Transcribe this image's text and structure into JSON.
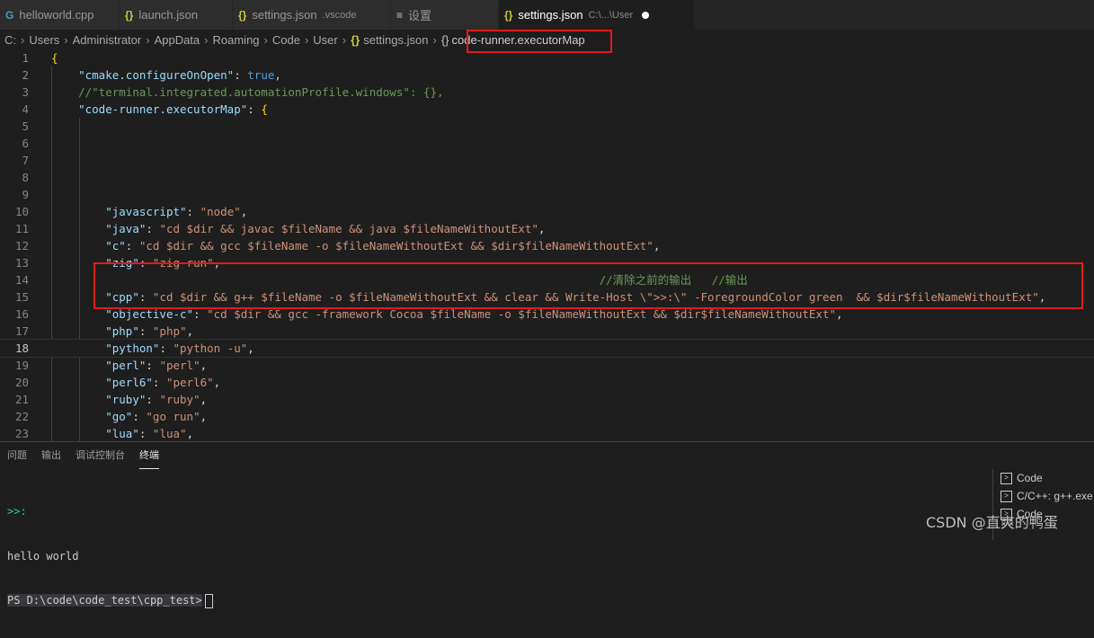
{
  "tabs": [
    {
      "icon": "cpp-file-icon",
      "glyph": "G",
      "label": "helloworld.cpp",
      "path": "",
      "active": false
    },
    {
      "icon": "json-file-icon",
      "glyph": "{}",
      "label": "launch.json",
      "path": "",
      "active": false
    },
    {
      "icon": "json-file-icon",
      "glyph": "{}",
      "label": "settings.json",
      "path": ".vscode",
      "active": false
    },
    {
      "icon": "settings-list-icon",
      "glyph": "≡",
      "label": "设置",
      "path": "",
      "active": false
    },
    {
      "icon": "json-file-icon",
      "glyph": "{}",
      "label": "settings.json",
      "path": "C:\\...\\User",
      "active": true
    }
  ],
  "breadcrumb": {
    "items": [
      "C:",
      "Users",
      "Administrator",
      "AppData",
      "Roaming",
      "Code",
      "User"
    ],
    "file_glyph": "{}",
    "file": "settings.json",
    "key_glyph": "{}",
    "key": "code-runner.executorMap"
  },
  "editor": {
    "current_line": 18,
    "lines": [
      {
        "n": "1",
        "code": [
          [
            "brk",
            "{"
          ]
        ]
      },
      {
        "n": "2",
        "code": [
          [
            "p",
            "    "
          ],
          [
            "k",
            "\"cmake.configureOnOpen\""
          ],
          [
            "p",
            ": "
          ],
          [
            "b",
            "true"
          ],
          [
            "p",
            ","
          ]
        ]
      },
      {
        "n": "3",
        "code": [
          [
            "p",
            "    "
          ],
          [
            "c",
            "//\"terminal.integrated.automationProfile.windows\": {},"
          ]
        ]
      },
      {
        "n": "4",
        "code": [
          [
            "p",
            "    "
          ],
          [
            "k",
            "\"code-runner.executorMap\""
          ],
          [
            "p",
            ": "
          ],
          [
            "brk",
            "{"
          ]
        ]
      },
      {
        "n": "5",
        "code": []
      },
      {
        "n": "6",
        "code": []
      },
      {
        "n": "7",
        "code": []
      },
      {
        "n": "8",
        "code": []
      },
      {
        "n": "9",
        "code": []
      },
      {
        "n": "10",
        "code": [
          [
            "p",
            "        "
          ],
          [
            "k",
            "\"javascript\""
          ],
          [
            "p",
            ": "
          ],
          [
            "s",
            "\"node\""
          ],
          [
            "p",
            ","
          ]
        ]
      },
      {
        "n": "11",
        "code": [
          [
            "p",
            "        "
          ],
          [
            "k",
            "\"java\""
          ],
          [
            "p",
            ": "
          ],
          [
            "s",
            "\"cd $dir && javac $fileName && java $fileNameWithoutExt\""
          ],
          [
            "p",
            ","
          ]
        ]
      },
      {
        "n": "12",
        "code": [
          [
            "p",
            "        "
          ],
          [
            "k",
            "\"c\""
          ],
          [
            "p",
            ": "
          ],
          [
            "s",
            "\"cd $dir && gcc $fileName -o $fileNameWithoutExt && $dir$fileNameWithoutExt\""
          ],
          [
            "p",
            ","
          ]
        ]
      },
      {
        "n": "13",
        "code": [
          [
            "p",
            "        "
          ],
          [
            "k",
            "\"zig\""
          ],
          [
            "p",
            ": "
          ],
          [
            "s",
            "\"zig run\""
          ],
          [
            "p",
            ","
          ]
        ]
      },
      {
        "n": "14",
        "code": [
          [
            "p",
            "                                                                                 "
          ],
          [
            "c",
            "//清除之前的输出   //输出"
          ]
        ]
      },
      {
        "n": "15",
        "code": [
          [
            "p",
            "        "
          ],
          [
            "k",
            "\"cpp\""
          ],
          [
            "p",
            ": "
          ],
          [
            "s",
            "\"cd $dir && g++ $fileName -o $fileNameWithoutExt && clear && Write-Host \\\">>:\\\" -ForegroundColor green  && $dir$fileNameWithoutExt\""
          ],
          [
            "p",
            ","
          ]
        ]
      },
      {
        "n": "16",
        "code": [
          [
            "p",
            "        "
          ],
          [
            "k",
            "\"objective-c\""
          ],
          [
            "p",
            ": "
          ],
          [
            "s",
            "\"cd $dir && gcc -framework Cocoa $fileName -o $fileNameWithoutExt && $dir$fileNameWithoutExt\""
          ],
          [
            "p",
            ","
          ]
        ]
      },
      {
        "n": "17",
        "code": [
          [
            "p",
            "        "
          ],
          [
            "k",
            "\"php\""
          ],
          [
            "p",
            ": "
          ],
          [
            "s",
            "\"php\""
          ],
          [
            "p",
            ","
          ]
        ]
      },
      {
        "n": "18",
        "code": [
          [
            "p",
            "        "
          ],
          [
            "k",
            "\"python\""
          ],
          [
            "p",
            ": "
          ],
          [
            "s",
            "\"python -u\""
          ],
          [
            "p",
            ","
          ]
        ]
      },
      {
        "n": "19",
        "code": [
          [
            "p",
            "        "
          ],
          [
            "k",
            "\"perl\""
          ],
          [
            "p",
            ": "
          ],
          [
            "s",
            "\"perl\""
          ],
          [
            "p",
            ","
          ]
        ]
      },
      {
        "n": "20",
        "code": [
          [
            "p",
            "        "
          ],
          [
            "k",
            "\"perl6\""
          ],
          [
            "p",
            ": "
          ],
          [
            "s",
            "\"perl6\""
          ],
          [
            "p",
            ","
          ]
        ]
      },
      {
        "n": "21",
        "code": [
          [
            "p",
            "        "
          ],
          [
            "k",
            "\"ruby\""
          ],
          [
            "p",
            ": "
          ],
          [
            "s",
            "\"ruby\""
          ],
          [
            "p",
            ","
          ]
        ]
      },
      {
        "n": "22",
        "code": [
          [
            "p",
            "        "
          ],
          [
            "k",
            "\"go\""
          ],
          [
            "p",
            ": "
          ],
          [
            "s",
            "\"go run\""
          ],
          [
            "p",
            ","
          ]
        ]
      },
      {
        "n": "23",
        "code": [
          [
            "p",
            "        "
          ],
          [
            "k",
            "\"lua\""
          ],
          [
            "p",
            ": "
          ],
          [
            "s",
            "\"lua\""
          ],
          [
            "p",
            ","
          ]
        ]
      }
    ]
  },
  "panel": {
    "tabs": [
      {
        "label": "问题",
        "active": false
      },
      {
        "label": "输出",
        "active": false
      },
      {
        "label": "调试控制台",
        "active": false
      },
      {
        "label": "终端",
        "active": true
      }
    ],
    "terminal": {
      "prompt_marker": ">>:",
      "output": "hello world",
      "prompt": "PS D:\\code\\code_test\\cpp_test>"
    },
    "terminal_list": [
      {
        "icon": "terminal-icon",
        "label": "Code"
      },
      {
        "icon": "terminal-icon",
        "label": "C/C++: g++.exe"
      },
      {
        "icon": "terminal-icon",
        "label": "Code"
      }
    ]
  },
  "watermark": "CSDN @直爽的鸭蛋",
  "colors": {
    "editor_bg": "#1e1e1e",
    "key": "#9cdcfe",
    "string": "#ce9178",
    "comment": "#6a9955",
    "keyword": "#569cd6",
    "highlight_box": "#e01b1b"
  }
}
